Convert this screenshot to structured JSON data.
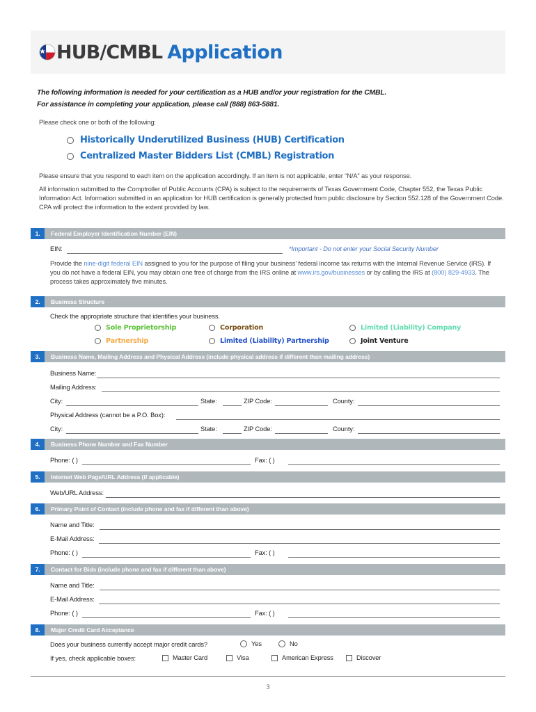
{
  "header": {
    "logo_icon": "texas-flag-icon",
    "brand": "HUB/CMBL",
    "brand_app": "Application"
  },
  "intro": {
    "line1": "The following information is needed for your certification as a HUB and/or your registration for the CMBL.",
    "line2": "For assistance in completing your application, please call (888) 863-5881.",
    "check_note": "Please check one or both of the following:",
    "options": [
      "Historically Underutilized Business (HUB) Certification",
      "Centralized Master Bidders List (CMBL) Registration"
    ],
    "para1": "Please ensure that you respond to each item on the application accordingly. If an item is not applicable, enter “N/A” as your response.",
    "para2_a": "All information submitted to the Comptroller of Public Accounts (CPA) is subject to the requirements of Texas Government Code, Chapter 552, the Texas Public Information Act. Information submitted in an application for HUB certification is generally protected from public disclosure by Section 552.128 of the Government Code. CPA will protect the information to the extent provided by law."
  },
  "sections": {
    "s1": {
      "num": "1.",
      "title": "Federal Employer Identification Number (EIN)",
      "ein_label": "EIN:",
      "ein_note": "*Important - Do not enter your Social Security Number",
      "body_1": "Provide the ",
      "body_link1": "nine-digit federal EIN",
      "body_2": " assigned to you for the purpose of filing your business’ federal income tax returns with the Internal Revenue Service (IRS). If you do not have a federal EIN, you may obtain one free of charge from the IRS online at ",
      "body_link2": "www.irs.gov/businesses",
      "body_3": " or by calling the IRS at ",
      "body_link3": "(800) 829-4933",
      "body_4": ". The process takes approximately five minutes."
    },
    "s2": {
      "num": "2.",
      "title": "Business Structure",
      "instruction": "Check the appropriate structure that identifies your business.",
      "options": [
        {
          "label": "Sole Proprietorship",
          "color": "#5cc238"
        },
        {
          "label": "Corporation",
          "color": "#7a5018"
        },
        {
          "label": "Limited (Liability) Company",
          "color": "#66dcb0"
        },
        {
          "label": "Partnership",
          "color": "#f5a844"
        },
        {
          "label": "Limited (Liability) Partnership",
          "color": "#1f4fc4"
        },
        {
          "label": "Joint Venture",
          "color": "#231f20"
        }
      ]
    },
    "s3": {
      "num": "3.",
      "title": "Business Name, Mailing Address and Physical Address (include physical address if different than mailing address)",
      "business_name": "Business Name:",
      "mailing_address": "Mailing Address:",
      "city": "City:",
      "state": "State:",
      "zip": "ZIP Code:",
      "county": "County:",
      "physical_address": "Physical Address (cannot be a P.O. Box):"
    },
    "s4": {
      "num": "4.",
      "title": "Business Phone Number and Fax Number",
      "phone": "Phone: (  )",
      "fax": "Fax: (       )"
    },
    "s5": {
      "num": "5.",
      "title": "Internet Web Page/URL Address (if applicable)",
      "web": "Web/URL Address:"
    },
    "s6": {
      "num": "6.",
      "title": "Primary Point of Contact (include phone and fax if different than above)",
      "name_title": "Name and Title:",
      "email": "E-Mail Address:",
      "phone": "Phone: (  )",
      "fax": "Fax: (       )"
    },
    "s7": {
      "num": "7.",
      "title": "Contact for Bids (include phone and fax if different than above)",
      "name_title": "Name and Title:",
      "email": "E-Mail Address:",
      "phone": "Phone: (  )",
      "fax": "Fax: (       )"
    },
    "s8": {
      "num": "8.",
      "title": "Major Credit Card Acceptance",
      "question": "Does your business currently accept major credit cards?",
      "yes": "Yes",
      "no": "No",
      "if_yes": "If yes, check applicable boxes:",
      "cards": [
        "Master Card",
        "Visa",
        "American Express",
        "Discover"
      ]
    }
  },
  "footer": {
    "page_number": "3"
  }
}
